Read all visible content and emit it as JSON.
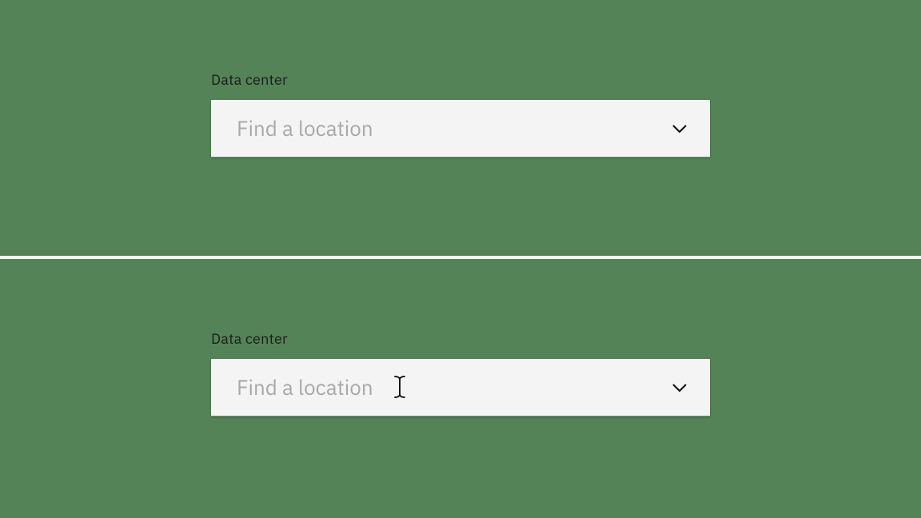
{
  "states": {
    "default": {
      "label": "Data center",
      "placeholder": "Find a location",
      "value": ""
    },
    "hover": {
      "label": "Data center",
      "placeholder": "Find a location",
      "value": ""
    }
  },
  "colors": {
    "background": "#538356",
    "field_bg": "#f4f4f4",
    "placeholder": "#a8a8a8",
    "label": "#1c1c1c",
    "chevron": "#161616"
  }
}
